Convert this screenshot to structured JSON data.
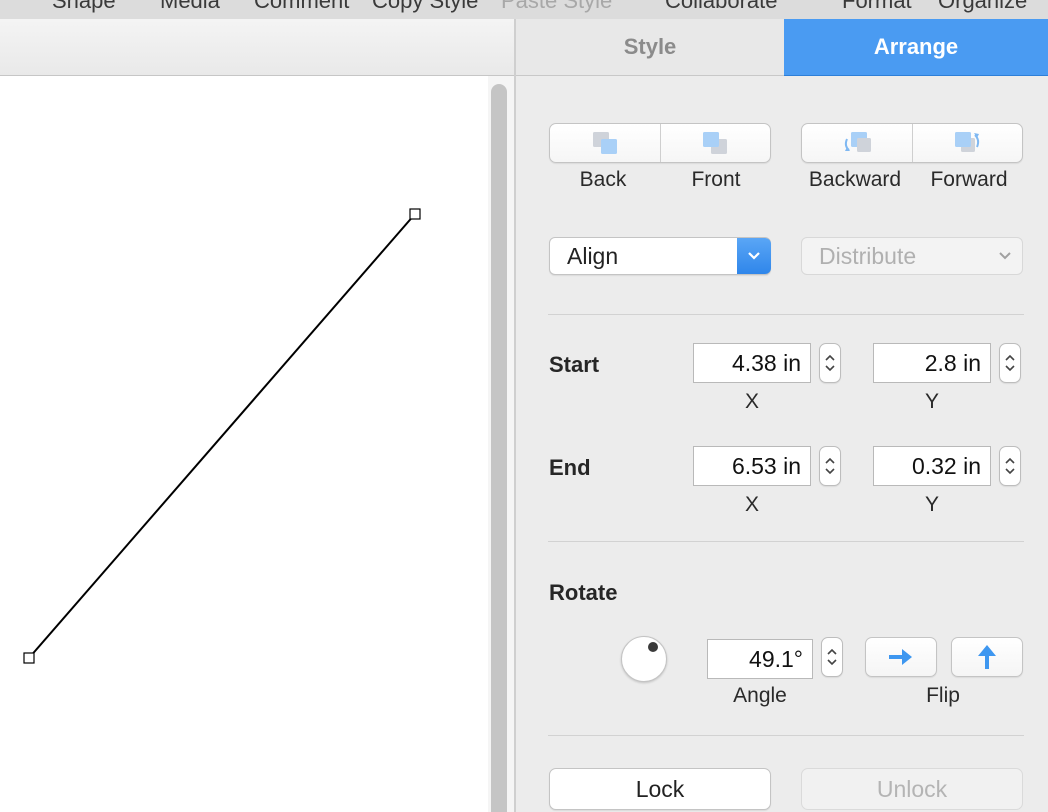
{
  "toolbar": {
    "items": [
      {
        "label": "Shape",
        "enabled": true
      },
      {
        "label": "Media",
        "enabled": true
      },
      {
        "label": "Comment",
        "enabled": true
      },
      {
        "label": "Copy Style",
        "enabled": true
      },
      {
        "label": "Paste Style",
        "enabled": false
      },
      {
        "label": "Collaborate",
        "enabled": true
      },
      {
        "label": "Format",
        "enabled": true
      },
      {
        "label": "Organize",
        "enabled": true
      }
    ]
  },
  "inspector": {
    "tabs": [
      {
        "label": "Style",
        "selected": false
      },
      {
        "label": "Arrange",
        "selected": true
      }
    ],
    "arrange_buttons": {
      "back": "Back",
      "front": "Front",
      "backward": "Backward",
      "forward": "Forward"
    },
    "align": {
      "label": "Align"
    },
    "distribute": {
      "label": "Distribute",
      "enabled": false
    },
    "start": {
      "label": "Start",
      "x": "4.38 in",
      "y": "2.8 in",
      "x_caption": "X",
      "y_caption": "Y"
    },
    "end": {
      "label": "End",
      "x": "6.53 in",
      "y": "0.32 in",
      "x_caption": "X",
      "y_caption": "Y"
    },
    "rotate": {
      "label": "Rotate",
      "angle": "49.1°",
      "angle_caption": "Angle",
      "flip_caption": "Flip"
    },
    "lock": {
      "label": "Lock"
    },
    "unlock": {
      "label": "Unlock",
      "enabled": false
    }
  },
  "colors": {
    "accent": "#4a9bf2",
    "panel_bg": "#ececec",
    "canvas_bg": "#ffffff"
  }
}
